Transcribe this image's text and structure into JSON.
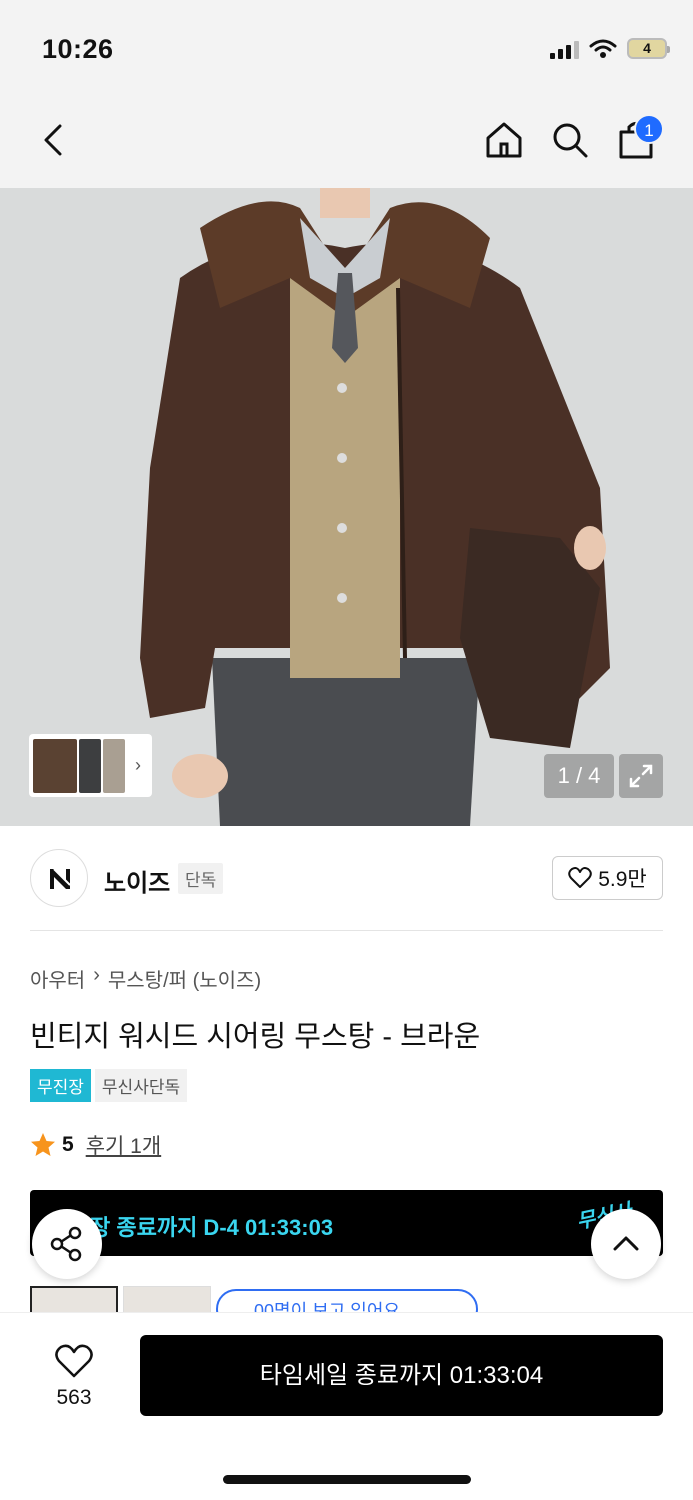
{
  "status_bar": {
    "time": "10:26",
    "battery": "4"
  },
  "nav": {
    "cart_count": "1"
  },
  "gallery": {
    "counter": "1 / 4"
  },
  "brand": {
    "name": "노이즈",
    "badge": "단독",
    "likes": "5.9만"
  },
  "breadcrumb": {
    "category": "아우터",
    "subcategory": "무스탕/퍼 (노이즈)"
  },
  "product": {
    "title": "빈티지 워시드 시어링 무스탕 - 브라운",
    "tags": [
      "무진장",
      "무신사단독"
    ],
    "rating": "5",
    "reviews": "후기 1개"
  },
  "banner": {
    "text": "장 종료까지 D-4 01:33:03",
    "logo": "무신사"
  },
  "options": {
    "viewers_text": "00명이 보고 있어요"
  },
  "bottom": {
    "wish_count": "563",
    "buy_label": "타임세일 종료까지 01:33:04"
  },
  "colors": {
    "accent_cyan": "#1fb8d3",
    "badge_blue": "#1f6bff",
    "banner_text": "#3ad6f0"
  }
}
